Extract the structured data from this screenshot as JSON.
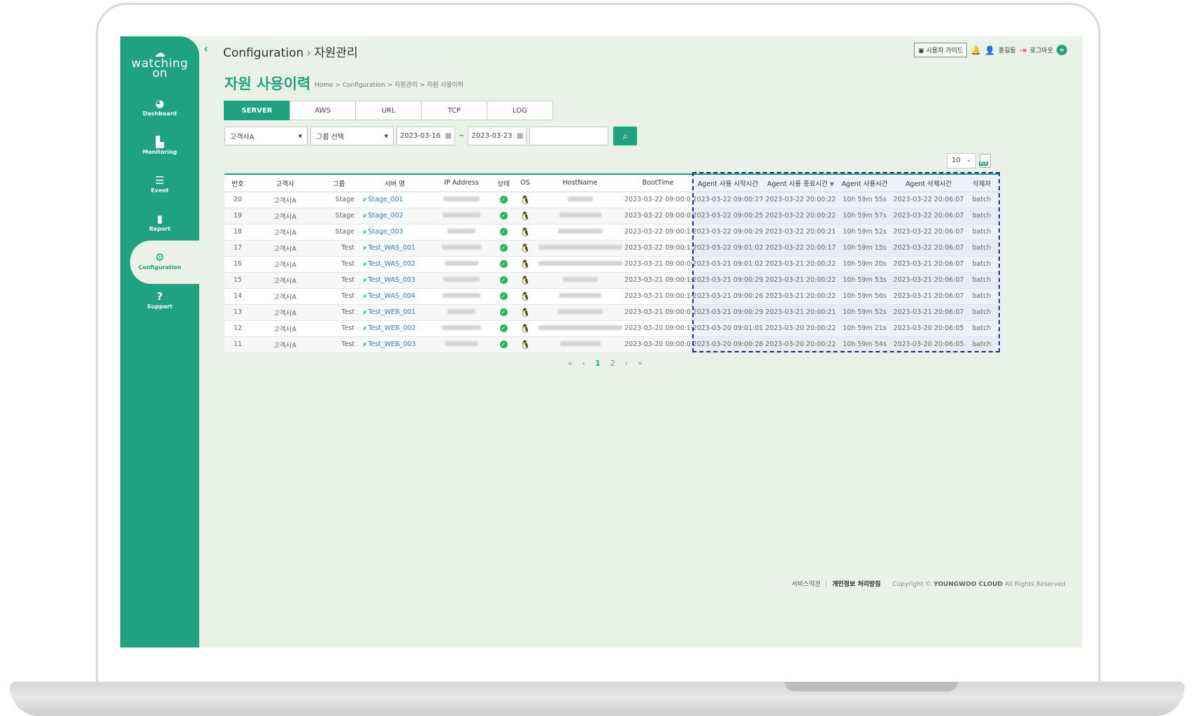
{
  "app": {
    "logo_line1": "watching",
    "logo_line2": "on"
  },
  "sidebar": {
    "items": [
      {
        "label": "Dashboard",
        "icon": "dashboard-gauge-icon"
      },
      {
        "label": "Monitoring",
        "icon": "bar-chart-icon"
      },
      {
        "label": "Event",
        "icon": "list-icon"
      },
      {
        "label": "Report",
        "icon": "clipboard-icon"
      },
      {
        "label": "Configuration",
        "icon": "gear-icon",
        "active": true
      },
      {
        "label": "Support",
        "icon": "question-icon"
      }
    ]
  },
  "header": {
    "section": "Configuration",
    "subsection": "자원관리",
    "guide_label": "사용자 가이드",
    "user_name": "홍길동",
    "logout_label": "로그아웃",
    "notification_count": "2"
  },
  "page": {
    "title": "자원 사용이력",
    "breadcrumb": "Home > Configuration > 자원관리 > 자원 사용이력"
  },
  "tabs": [
    "SERVER",
    "AWS",
    "URL",
    "TCP",
    "LOG"
  ],
  "filters": {
    "customer": "고객사A",
    "group": "그룹 선택",
    "date_from": "2023-03-16",
    "date_to": "2023-03-23",
    "tilde": "~",
    "search_value": ""
  },
  "page_size": "10",
  "table": {
    "headers": [
      "번호",
      "고객사",
      "그룹",
      "서버 명",
      "IP Address",
      "상태",
      "OS",
      "HostName",
      "BootTime",
      "Agent 사용 시작시간",
      "Agent 사용 종료시간",
      "Agent 사용시간",
      "Agent 삭제시간",
      "삭제자"
    ],
    "rows": [
      {
        "no": "20",
        "customer": "고객사A",
        "group": "Stage",
        "server": "Stage_001",
        "boot": "2023-03-22 09:00:05",
        "start": "2023-03-22 09:00:27",
        "end": "2023-03-22 20:00:22",
        "usage": "10h 59m 55s",
        "deleted": "2023-03-22 20:06:07",
        "deleter": "batch"
      },
      {
        "no": "19",
        "customer": "고객사A",
        "group": "Stage",
        "server": "Stage_002",
        "boot": "2023-03-22 09:00:05",
        "start": "2023-03-22 09:00:25",
        "end": "2023-03-22 20:00:22",
        "usage": "10h 59m 57s",
        "deleted": "2023-03-22 20:06:07",
        "deleter": "batch"
      },
      {
        "no": "18",
        "customer": "고객사A",
        "group": "Stage",
        "server": "Stage_003",
        "boot": "2023-03-22 09:00:10",
        "start": "2023-03-22 09:00:29",
        "end": "2023-03-22 20:00:21",
        "usage": "10h 59m 52s",
        "deleted": "2023-03-22 20:06:07",
        "deleter": "batch"
      },
      {
        "no": "17",
        "customer": "고객사A",
        "group": "Test",
        "server": "Test_WAS_001",
        "boot": "2023-03-22 09:00:13",
        "start": "2023-03-22 09:01:02",
        "end": "2023-03-22 20:00:17",
        "usage": "10h 59m 15s",
        "deleted": "2023-03-22 20:06:07",
        "deleter": "batch"
      },
      {
        "no": "16",
        "customer": "고객사A",
        "group": "Test",
        "server": "Test_WAS_002",
        "boot": "2023-03-21 09:00:06",
        "start": "2023-03-21 09:01:02",
        "end": "2023-03-21 20:00:22",
        "usage": "10h 59m 20s",
        "deleted": "2023-03-21 20:06:07",
        "deleter": "batch"
      },
      {
        "no": "15",
        "customer": "고객사A",
        "group": "Test",
        "server": "Test_WAS_003",
        "boot": "2023-03-21 09:00:10",
        "start": "2023-03-21 09:00:29",
        "end": "2023-03-21 20:00:22",
        "usage": "10h 59m 53s",
        "deleted": "2023-03-21 20:06:07",
        "deleter": "batch"
      },
      {
        "no": "14",
        "customer": "고객사A",
        "group": "Test",
        "server": "Test_WAS_004",
        "boot": "2023-03-21 09:00:16",
        "start": "2023-03-21 09:00:26",
        "end": "2023-03-21 20:00:22",
        "usage": "10h 59m 56s",
        "deleted": "2023-03-21 20:06:07",
        "deleter": "batch"
      },
      {
        "no": "13",
        "customer": "고객사A",
        "group": "Test",
        "server": "Test_WEB_001",
        "boot": "2023-03-21 09:00:05",
        "start": "2023-03-21 09:00:29",
        "end": "2023-03-21 20:00:21",
        "usage": "10h 59m 52s",
        "deleted": "2023-03-21 20:06:07",
        "deleter": "batch"
      },
      {
        "no": "12",
        "customer": "고객사A",
        "group": "Test",
        "server": "Test_WEB_002",
        "boot": "2023-03-20 09:00:10",
        "start": "2023-03-20 09:01:01",
        "end": "2023-03-20 20:00:22",
        "usage": "10h 59m 21s",
        "deleted": "2023-03-20 20:06:05",
        "deleter": "batch"
      },
      {
        "no": "11",
        "customer": "고객사A",
        "group": "Test",
        "server": "Test_WEB_003",
        "boot": "2023-03-20 09:00:05",
        "start": "2023-03-20 09:00:28",
        "end": "2023-03-20 20:00:22",
        "usage": "10h 59m 54s",
        "deleted": "2023-03-20 20:06:05",
        "deleter": "batch"
      }
    ]
  },
  "pagination": {
    "first": "«",
    "prev": "‹",
    "pages": [
      "1",
      "2"
    ],
    "current": "1",
    "next": "›",
    "last": "»"
  },
  "footer": {
    "terms": "서비스약관",
    "privacy": "개인정보 처리방침",
    "copyright_prefix": "Copyright ©",
    "company": "YOUNGWOO CLOUD",
    "rights": "All Rights Reserved"
  },
  "colors": {
    "brand": "#1ea37e",
    "link": "#1d8cc4",
    "status_ok": "#27b35a",
    "highlight_border": "#1b2f86"
  }
}
